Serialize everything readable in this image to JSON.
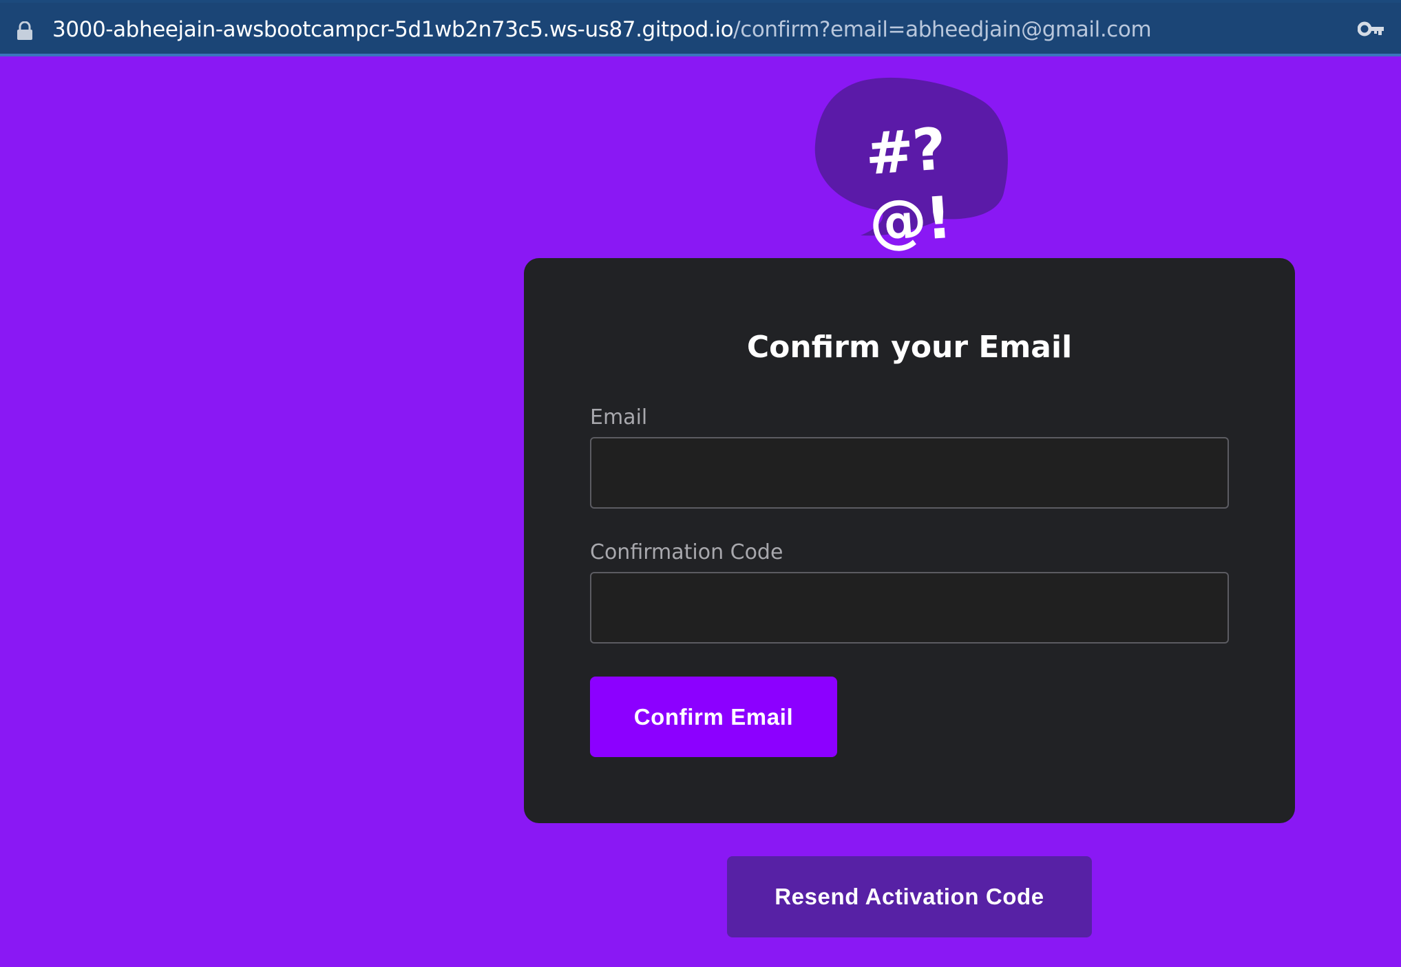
{
  "browser": {
    "url_host": "3000-abheejain-awsbootcampcr-5d1wb2n73c5.ws-us87.gitpod.io",
    "url_path": "/confirm?email=abheedjain@gmail.com",
    "icons": {
      "lock": "lock-icon",
      "key": "key-icon"
    }
  },
  "logo": {
    "text": "#?@!",
    "colors": {
      "bubble": "#5b1aa8",
      "text": "#ffffff"
    }
  },
  "form": {
    "title": "Confirm your Email",
    "email_label": "Email",
    "email_value": "",
    "code_label": "Confirmation Code",
    "code_value": "",
    "submit_label": "Confirm Email"
  },
  "resend": {
    "label": "Resend Activation Code"
  },
  "colors": {
    "page_background": "#8a18f4",
    "card_background": "#212225",
    "primary_button": "#8c00ff",
    "secondary_button": "#5721a5",
    "address_bar": "#1c4a7d"
  }
}
